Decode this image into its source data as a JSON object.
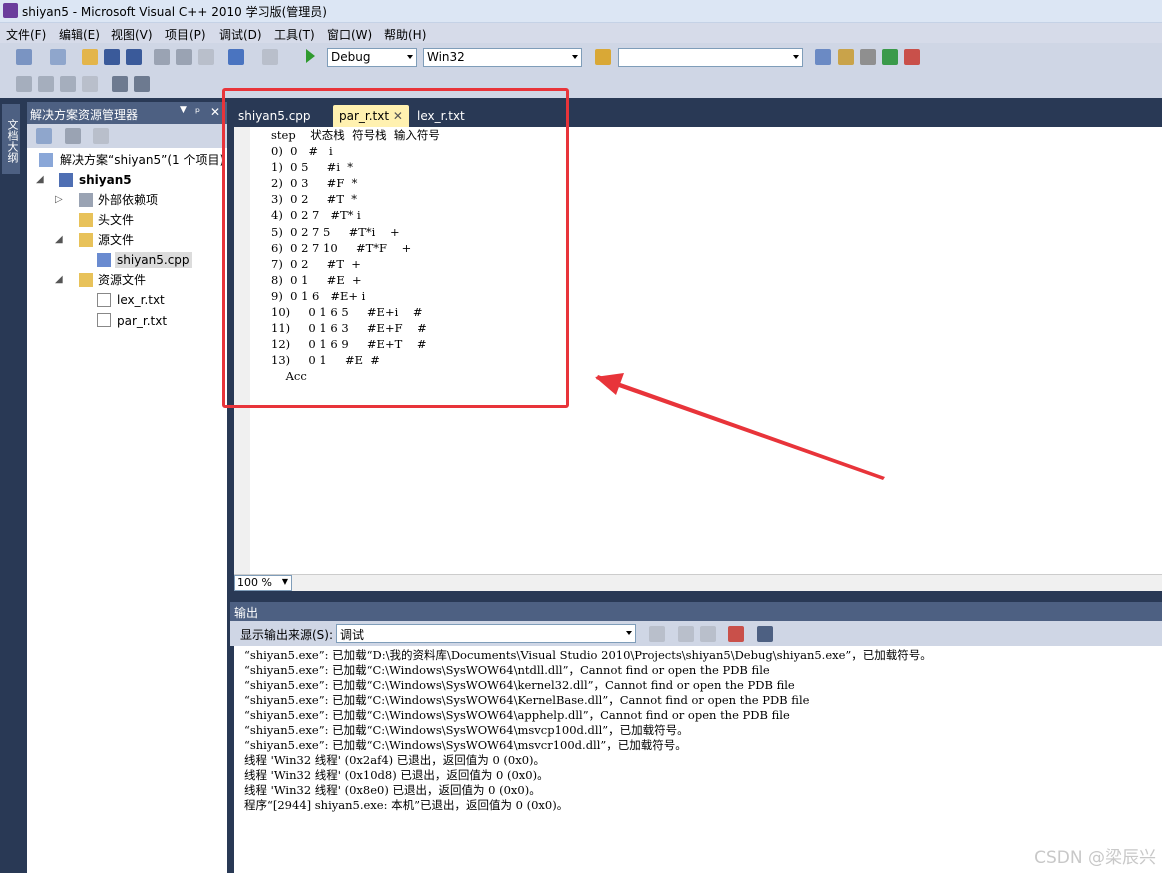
{
  "window": {
    "title": "shiyan5 - Microsoft Visual C++ 2010 学习版(管理员)"
  },
  "menu": [
    "文件(F)",
    "编辑(E)",
    "视图(V)",
    "项目(P)",
    "调试(D)",
    "工具(T)",
    "窗口(W)",
    "帮助(H)"
  ],
  "toolbar": {
    "config": "Debug",
    "platform": "Win32",
    "search": ""
  },
  "solution_explorer": {
    "title": "解决方案资源管理器",
    "pin": "ᵖ",
    "close": "✕",
    "solution": "解决方案“shiyan5”(1 个项目)",
    "project": "shiyan5",
    "ext_deps": "外部依赖项",
    "headers": "头文件",
    "sources": "源文件",
    "source_file": "shiyan5.cpp",
    "resources": "资源文件",
    "res_file1": "lex_r.txt",
    "res_file2": "par_r.txt"
  },
  "side_tab": "文档大纲",
  "tabs": [
    {
      "label": "shiyan5.cpp"
    },
    {
      "label": "par_r.txt",
      "close": "✕"
    },
    {
      "label": "lex_r.txt"
    }
  ],
  "editor_lines": [
    "step    状态栈  符号栈  输入符号",
    "0)  0   #   i",
    "1)  0 5     #i  *",
    "2)  0 3     #F  *",
    "3)  0 2     #T  *",
    "4)  0 2 7   #T* i",
    "5)  0 2 7 5     #T*i    +",
    "6)  0 2 7 10     #T*F    +",
    "7)  0 2     #T  +",
    "8)  0 1     #E  +",
    "9)  0 1 6   #E+ i",
    "10)     0 1 6 5     #E+i    #",
    "11)     0 1 6 3     #E+F    #",
    "12)     0 1 6 9     #E+T    #",
    "13)     0 1     #E  #",
    "    Acc"
  ],
  "zoom": "100 %",
  "output": {
    "title": "输出",
    "source_label": "显示输出来源(S):",
    "source_value": "调试",
    "lines": [
      "“shiyan5.exe”: 已加载“D:\\我的资料库\\Documents\\Visual Studio 2010\\Projects\\shiyan5\\Debug\\shiyan5.exe”，已加载符号。",
      "“shiyan5.exe”: 已加载“C:\\Windows\\SysWOW64\\ntdll.dll”，Cannot find or open the PDB file",
      "“shiyan5.exe”: 已加载“C:\\Windows\\SysWOW64\\kernel32.dll”，Cannot find or open the PDB file",
      "“shiyan5.exe”: 已加载“C:\\Windows\\SysWOW64\\KernelBase.dll”，Cannot find or open the PDB file",
      "“shiyan5.exe”: 已加载“C:\\Windows\\SysWOW64\\apphelp.dll”，Cannot find or open the PDB file",
      "“shiyan5.exe”: 已加载“C:\\Windows\\SysWOW64\\msvcp100d.dll”，已加载符号。",
      "“shiyan5.exe”: 已加载“C:\\Windows\\SysWOW64\\msvcr100d.dll”，已加载符号。",
      "线程 'Win32 线程' (0x2af4) 已退出，返回值为 0 (0x0)。",
      "线程 'Win32 线程' (0x10d8) 已退出，返回值为 0 (0x0)。",
      "线程 'Win32 线程' (0x8e0) 已退出，返回值为 0 (0x0)。",
      "程序“[2944] shiyan5.exe: 本机”已退出，返回值为 0 (0x0)。"
    ]
  },
  "watermark": "CSDN @梁辰兴",
  "colors": {
    "frame": "#293955",
    "highlight": "#e8343a",
    "active_tab": "#fff1b0"
  }
}
